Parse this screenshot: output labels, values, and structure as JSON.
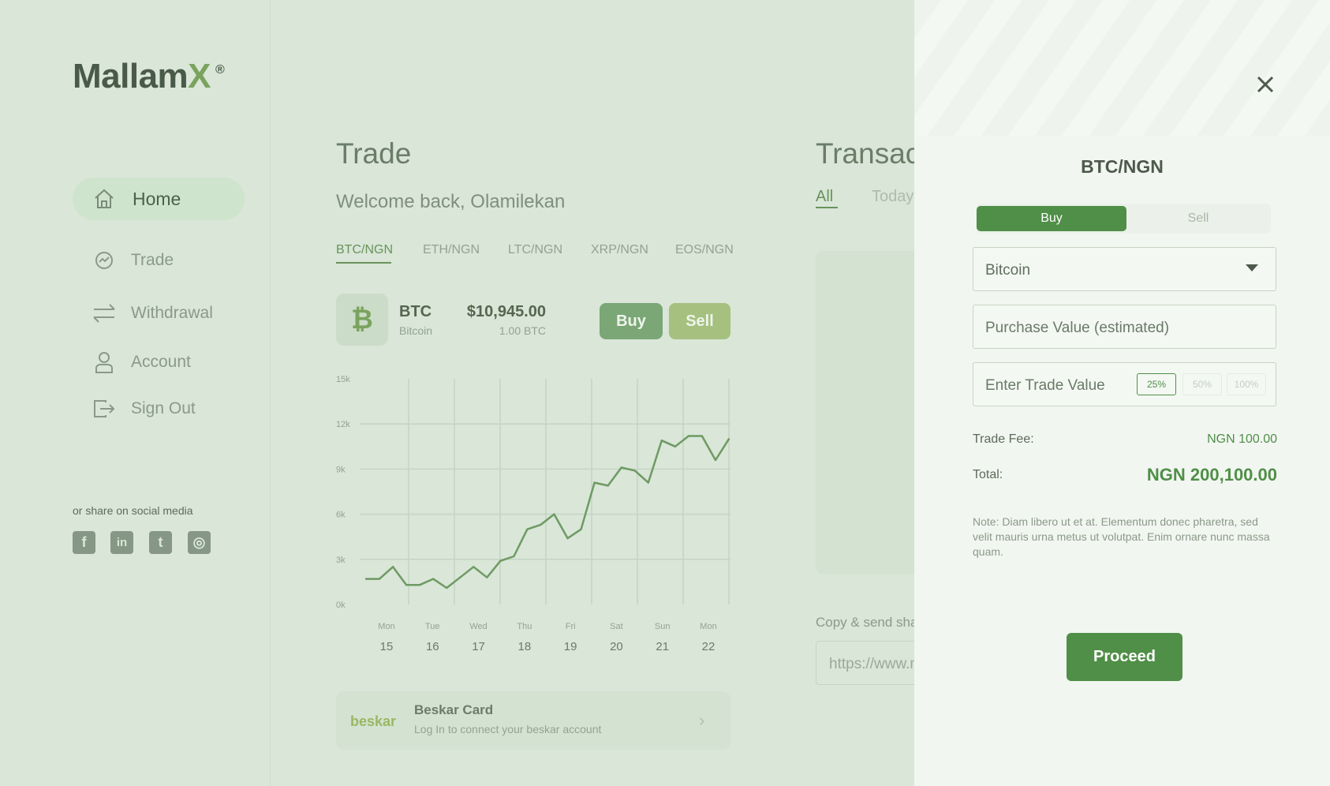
{
  "brand": {
    "name": "Mallam",
    "mark": "X",
    "reg": "®"
  },
  "sidebar": {
    "items": [
      {
        "label": "Home",
        "icon": "home-icon",
        "active": true
      },
      {
        "label": "Trade",
        "icon": "trade-icon"
      },
      {
        "label": "Withdrawal",
        "icon": "transfer-icon"
      },
      {
        "label": "Account",
        "icon": "user-icon"
      },
      {
        "label": "Sign Out",
        "icon": "sign-out-icon"
      }
    ],
    "social_label": "or share on social media",
    "social": [
      {
        "name": "facebook",
        "glyph": "f"
      },
      {
        "name": "linkedin",
        "glyph": "in"
      },
      {
        "name": "twitter",
        "glyph": "t"
      },
      {
        "name": "instagram",
        "glyph": "◎"
      }
    ]
  },
  "trade": {
    "title": "Trade",
    "welcome": "Welcome back, Olamilekan",
    "pairs": [
      "BTC/NGN",
      "ETH/NGN",
      "LTC/NGN",
      "XRP/NGN",
      "EOS/NGN"
    ],
    "active_pair": "BTC/NGN",
    "coin": {
      "icon_glyph": "₿",
      "symbol": "BTC",
      "name": "Bitcoin",
      "price": "$10,945.00",
      "amount": "1.00 BTC"
    },
    "buy_label": "Buy",
    "sell_label": "Sell"
  },
  "chart_data": {
    "type": "line",
    "x": [
      "15",
      "16",
      "17",
      "18",
      "19",
      "20",
      "21",
      "22"
    ],
    "day_labels": [
      "Mon",
      "Tue",
      "Wed",
      "Thu",
      "Fri",
      "Sat",
      "Sun",
      "Mon"
    ],
    "yticks": [
      "0k",
      "3k",
      "6k",
      "9k",
      "12k",
      "15k"
    ],
    "ylim": [
      0,
      15
    ],
    "series": [
      {
        "values": [
          1.7,
          1.7,
          2.5,
          1.3,
          1.3,
          1.7,
          1.1,
          1.8,
          2.5,
          1.8,
          2.9,
          3.2,
          5.0,
          5.3,
          6.0,
          4.4,
          5.0,
          8.1,
          7.9,
          9.1,
          8.9,
          8.1,
          10.9,
          10.5,
          11.2,
          11.2,
          9.6,
          11.0
        ]
      }
    ],
    "grid": true
  },
  "beskar": {
    "logo": "beskar",
    "title": "Beskar Card",
    "subtitle": "Log In to connect your beskar account"
  },
  "transactions": {
    "title": "Transactions",
    "tabs": [
      "All",
      "Today"
    ],
    "copy_label": "Copy & send share link",
    "copy_value": "https://www.mallamx.com"
  },
  "panel": {
    "title": "BTC/NGN",
    "segments": [
      "Buy",
      "Sell"
    ],
    "asset_select": "Bitcoin",
    "purchase_placeholder": "Purchase Value (estimated)",
    "trade_placeholder": "Enter Trade Value",
    "percents": [
      "25%",
      "50%",
      "100%"
    ],
    "fee_label": "Trade Fee:",
    "fee_value": "NGN 100.00",
    "total_label": "Total:",
    "total_value": "NGN 200,100.00",
    "note": "Note: Diam libero ut et at. Elementum donec pharetra, sed velit mauris urna metus ut volutpat. Enim ornare nunc massa quam.",
    "proceed_label": "Proceed"
  }
}
